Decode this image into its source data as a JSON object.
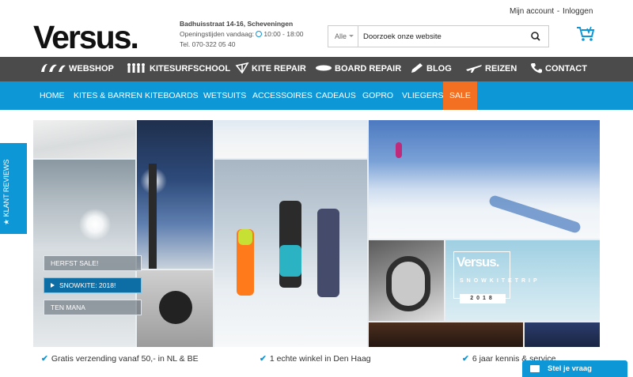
{
  "header": {
    "logo": "Versus.",
    "address": "Badhuisstraat 14-16, Scheveningen",
    "hours_label": "Openingstijden vandaag:",
    "hours_value": "10:00 - 18:00",
    "phone": "Tel. 070-322 05 40",
    "account_link": "Mijn account",
    "separator": "-",
    "login_link": "Inloggen"
  },
  "search": {
    "category": "Alle",
    "placeholder": "Doorzoek onze website"
  },
  "main_nav": {
    "items": [
      {
        "label": "WEBSHOP",
        "icon": "kites-icon"
      },
      {
        "label": "KITESURFSCHOOL",
        "icon": "people-icon"
      },
      {
        "label": "KITE REPAIR",
        "icon": "kite-repair-icon"
      },
      {
        "label": "BOARD REPAIR",
        "icon": "board-icon"
      },
      {
        "label": "BLOG",
        "icon": "pencil-icon"
      },
      {
        "label": "REIZEN",
        "icon": "plane-icon"
      },
      {
        "label": "CONTACT",
        "icon": "phone-icon"
      }
    ]
  },
  "category_nav": {
    "items": [
      "HOME",
      "KITES & BARREN",
      "KITEBOARDS",
      "WETSUITS",
      "ACCESSOIRES",
      "CADEAUS",
      "GOPRO",
      "VLIEGERS",
      "SALE"
    ]
  },
  "reviews_tab": "★ KLANT REVIEWS",
  "promos": [
    "HERFST SALE!",
    "SNOWKITE: 2018!",
    "TEN MANA"
  ],
  "snowkite_card": {
    "brand": "Versus.",
    "subtitle": "SNOWKITETRIP",
    "year": "2018"
  },
  "usps": [
    "Gratis verzending vanaf 50,- in NL & BE",
    "1 echte winkel in Den Haag",
    "6 jaar kennis & service"
  ],
  "chat_button": "Stel je vraag",
  "colors": {
    "primary": "#0d97d7",
    "nav_dark": "#4b4b4b",
    "sale": "#f36f21"
  }
}
